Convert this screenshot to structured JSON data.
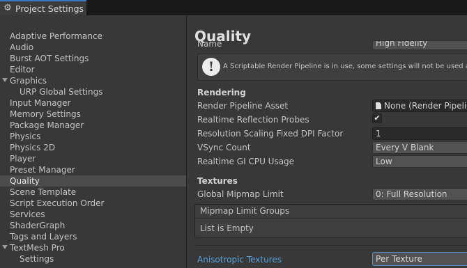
{
  "window": {
    "tab_title": "Project Settings",
    "tab_icon": "gear-icon"
  },
  "sidebar": {
    "items": [
      {
        "label": "Adaptive Performance"
      },
      {
        "label": "Audio"
      },
      {
        "label": "Burst AOT Settings"
      },
      {
        "label": "Editor"
      },
      {
        "label": "Graphics",
        "expanded": true
      },
      {
        "label": "URP Global Settings"
      },
      {
        "label": "Input Manager"
      },
      {
        "label": "Memory Settings"
      },
      {
        "label": "Package Manager"
      },
      {
        "label": "Physics"
      },
      {
        "label": "Physics 2D"
      },
      {
        "label": "Player"
      },
      {
        "label": "Preset Manager"
      },
      {
        "label": "Quality",
        "selected": true
      },
      {
        "label": "Scene Template"
      },
      {
        "label": "Script Execution Order"
      },
      {
        "label": "Services"
      },
      {
        "label": "ShaderGraph"
      },
      {
        "label": "Tags and Layers"
      },
      {
        "label": "TextMesh Pro",
        "expanded": true
      },
      {
        "label": "Settings"
      }
    ]
  },
  "main": {
    "title": "Quality",
    "name_label": "Name",
    "name_value": "High Fidelity",
    "info_message": "A Scriptable Render Pipeline is in use, some settings will not be used and a",
    "rendering": {
      "header": "Rendering",
      "pipeline_asset_label": "Render Pipeline Asset",
      "pipeline_asset_value": "None (Render Pipeline",
      "reflection_probes_label": "Realtime Reflection Probes",
      "reflection_probes_checked": true,
      "dpi_label": "Resolution Scaling Fixed DPI Factor",
      "dpi_value": "1",
      "vsync_label": "VSync Count",
      "vsync_value": "Every V Blank",
      "gi_label": "Realtime GI CPU Usage",
      "gi_value": "Low"
    },
    "textures": {
      "header": "Textures",
      "mipmap_limit_label": "Global Mipmap Limit",
      "mipmap_limit_value": "0: Full Resolution",
      "mipmap_groups_header": "Mipmap Limit Groups",
      "mipmap_groups_empty": "List is Empty",
      "aniso_label": "Anisotropic Textures",
      "aniso_value": "Per Texture"
    }
  },
  "colors": {
    "background": "#383838",
    "selected_row": "#4b4b4b",
    "accent_blue": "#5aa0dc",
    "tab_highlight": "#3a79bb"
  }
}
